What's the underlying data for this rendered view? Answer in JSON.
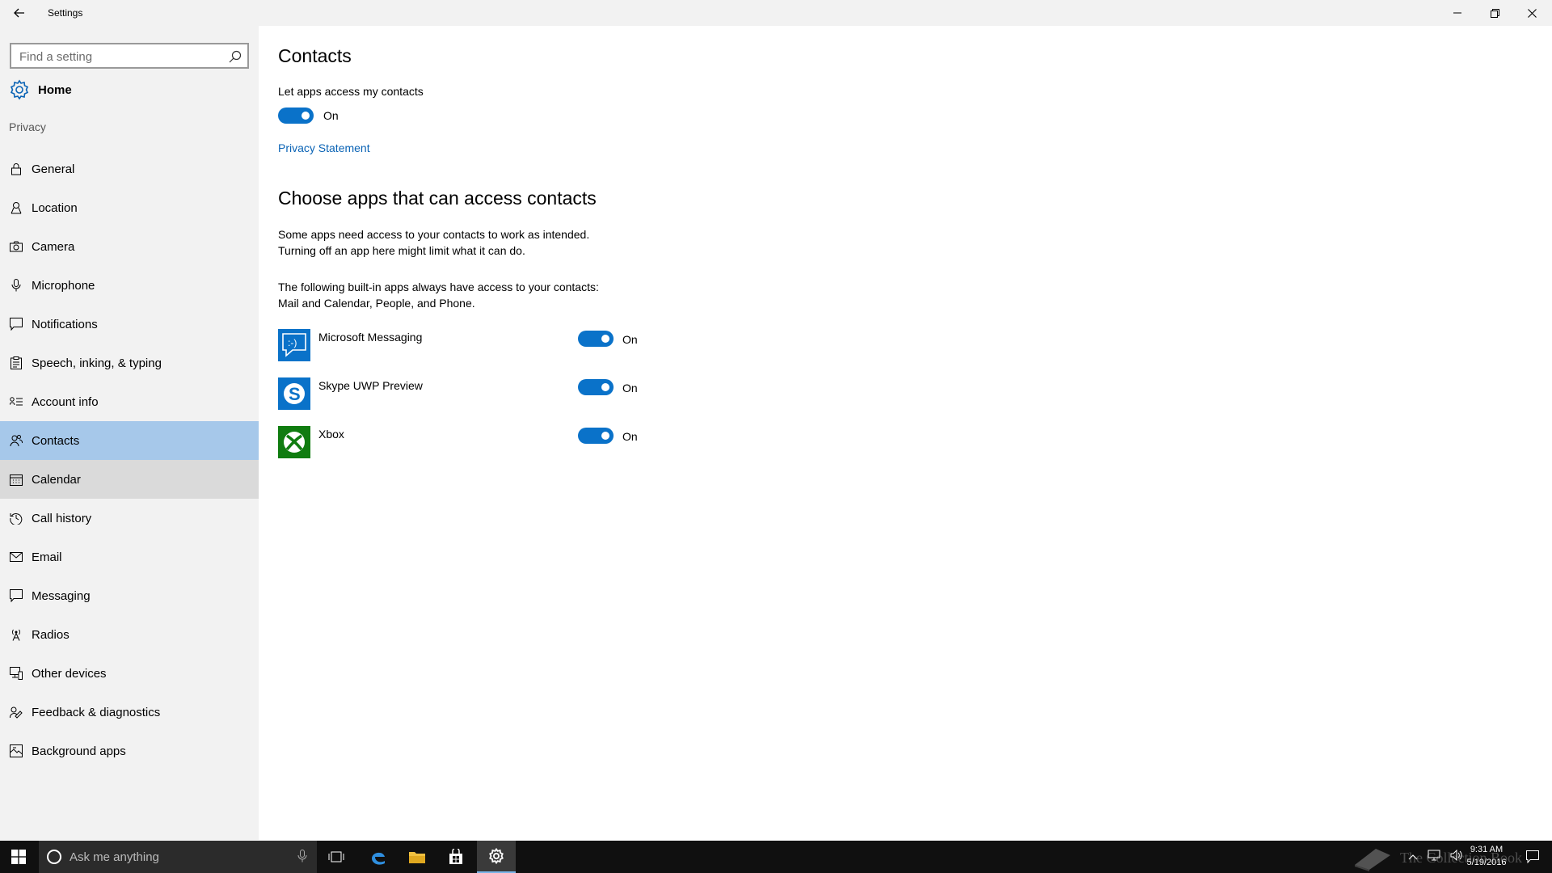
{
  "window": {
    "title": "Settings"
  },
  "sidebar": {
    "search_placeholder": "Find a setting",
    "home_label": "Home",
    "section_label": "Privacy",
    "items": [
      {
        "label": "General",
        "icon": "lock-icon"
      },
      {
        "label": "Location",
        "icon": "location-icon"
      },
      {
        "label": "Camera",
        "icon": "camera-icon"
      },
      {
        "label": "Microphone",
        "icon": "microphone-icon"
      },
      {
        "label": "Notifications",
        "icon": "notification-icon"
      },
      {
        "label": "Speech, inking, & typing",
        "icon": "clipboard-icon"
      },
      {
        "label": "Account info",
        "icon": "account-info-icon"
      },
      {
        "label": "Contacts",
        "icon": "contacts-icon",
        "selected": true
      },
      {
        "label": "Calendar",
        "icon": "calendar-icon"
      },
      {
        "label": "Call history",
        "icon": "history-icon"
      },
      {
        "label": "Email",
        "icon": "email-icon"
      },
      {
        "label": "Messaging",
        "icon": "message-icon"
      },
      {
        "label": "Radios",
        "icon": "radio-tower-icon"
      },
      {
        "label": "Other devices",
        "icon": "devices-icon"
      },
      {
        "label": "Feedback & diagnostics",
        "icon": "feedback-icon"
      },
      {
        "label": "Background apps",
        "icon": "background-apps-icon"
      }
    ]
  },
  "main": {
    "title": "Contacts",
    "access_label": "Let apps access my contacts",
    "access_state": "On",
    "privacy_link": "Privacy Statement",
    "choose_title": "Choose apps that can access contacts",
    "desc1_line1": "Some apps need access to your contacts to work as intended.",
    "desc1_line2": "Turning off an app here might limit what it can do.",
    "desc2_line1": "The following built-in apps always have access to your contacts:",
    "desc2_line2": "Mail and Calendar, People, and Phone.",
    "apps": [
      {
        "name": "Microsoft Messaging",
        "state": "On",
        "icon": "messaging-app-icon",
        "color": "#0a72c9"
      },
      {
        "name": "Skype UWP Preview",
        "state": "On",
        "icon": "skype-app-icon",
        "color": "#0a72c9"
      },
      {
        "name": "Xbox",
        "state": "On",
        "icon": "xbox-app-icon",
        "color": "#107c10"
      }
    ]
  },
  "taskbar": {
    "search_placeholder": "Ask me anything",
    "time": "9:31 AM",
    "date": "5/19/2016",
    "watermark": "The Collection Book"
  },
  "colors": {
    "accent": "#0a72c9",
    "selected_bg": "#a6c8ea",
    "sidebar_bg": "#f2f2f2",
    "taskbar_bg": "#101010"
  }
}
